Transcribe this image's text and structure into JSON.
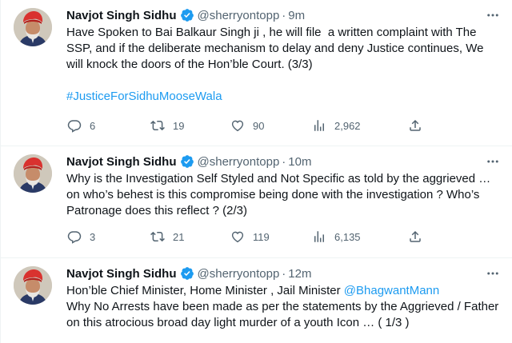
{
  "tweets": [
    {
      "name": "Navjot Singh Sidhu",
      "handle": "@sherryontopp",
      "dot": "·",
      "time": "9m",
      "text": "Have Spoken to Bai Balkaur Singh ji , he will file  a written complaint with The SSP, and if the deliberate mechanism to delay and deny Justice continues, We will knock the doors of the Hon’ble Court. (3/3)",
      "hashtag": "#JusticeForSidhuMooseWala",
      "replies": "6",
      "retweets": "19",
      "likes": "90",
      "views": "2,962"
    },
    {
      "name": "Navjot Singh Sidhu",
      "handle": "@sherryontopp",
      "dot": "·",
      "time": "10m",
      "text": "Why is the Investigation Self Styled and Not Specific as told by the aggrieved … on who’s behest is this compromise being done with the investigation ? Who’s Patronage does this reflect ? (2/3)",
      "replies": "3",
      "retweets": "21",
      "likes": "119",
      "views": "6,135"
    },
    {
      "name": "Navjot Singh Sidhu",
      "handle": "@sherryontopp",
      "dot": "·",
      "time": "12m",
      "text_before_mention": "Hon’ble Chief Minister, Home Minister , Jail Minister ",
      "mention": "@BhagwantMann",
      "text_after_mention": "\nWhy No Arrests have been made as per the statements by the Aggrieved / Father on this atrocious broad day light murder of a youth Icon … ( 1/3 )"
    }
  ],
  "icons": {
    "verified": "verified-badge-icon",
    "more": "more-icon",
    "reply": "reply-icon",
    "retweet": "retweet-icon",
    "like": "heart-icon",
    "views": "views-icon",
    "share": "share-icon"
  },
  "colors": {
    "link": "#1d9bf0",
    "muted": "#536471",
    "text": "#0f1419",
    "divider": "#eff3f4",
    "verified": "#1d9bf0"
  }
}
